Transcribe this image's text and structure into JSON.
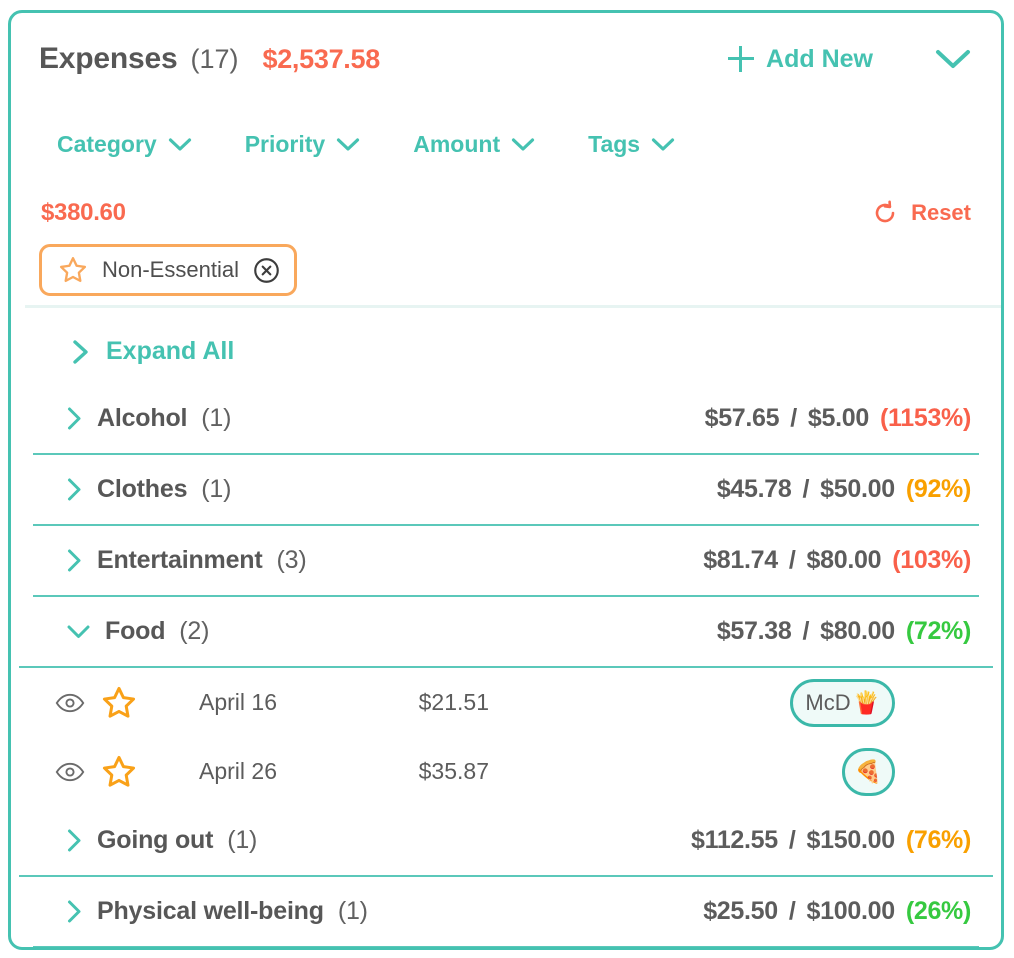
{
  "header": {
    "title": "Expenses",
    "count": "(17)",
    "grand_total": "$2,537.58",
    "add_new_label": "Add New",
    "plus_icon": "plus-icon",
    "collapse_icon": "chevron-down-icon"
  },
  "filters": [
    {
      "label": "Category",
      "icon": "chevron-down-icon"
    },
    {
      "label": "Priority",
      "icon": "chevron-down-icon"
    },
    {
      "label": "Amount",
      "icon": "chevron-down-icon"
    },
    {
      "label": "Tags",
      "icon": "chevron-down-icon"
    }
  ],
  "subtotal": {
    "filtered_total": "$380.60",
    "reset_label": "Reset",
    "reset_icon": "refresh-ccw-icon"
  },
  "chips": [
    {
      "label": "Non-Essential",
      "star_icon": "star-outline-icon",
      "close_icon": "close-circle-icon"
    }
  ],
  "list": {
    "expand_all_label": "Expand All",
    "expand_all_icon": "chevron-right-icon",
    "categories": [
      {
        "name": "Alcohol",
        "count": "(1)",
        "spent": "$57.65",
        "separator": "/",
        "budget": "$5.00",
        "percent": "(1153%)",
        "percent_color": "#f9604a",
        "expanded": false,
        "chevron": "chevron-right-icon",
        "expenses": []
      },
      {
        "name": "Clothes",
        "count": "(1)",
        "spent": "$45.78",
        "separator": "/",
        "budget": "$50.00",
        "percent": "(92%)",
        "percent_color": "#f9a000",
        "expanded": false,
        "chevron": "chevron-right-icon",
        "expenses": []
      },
      {
        "name": "Entertainment",
        "count": "(3)",
        "spent": "$81.74",
        "separator": "/",
        "budget": "$80.00",
        "percent": "(103%)",
        "percent_color": "#f9604a",
        "expanded": false,
        "chevron": "chevron-right-icon",
        "expenses": []
      },
      {
        "name": "Food",
        "count": "(2)",
        "spent": "$57.38",
        "separator": "/",
        "budget": "$80.00",
        "percent": "(72%)",
        "percent_color": "#36c940",
        "expanded": true,
        "chevron": "chevron-down-icon",
        "expenses": [
          {
            "eye_icon": "eye-icon",
            "star_icon": "star-outline-icon",
            "date": "April 16",
            "amount": "$21.51",
            "tags": [
              {
                "label": "McD",
                "emoji": "🍟",
                "shape": "pill"
              }
            ]
          },
          {
            "eye_icon": "eye-icon",
            "star_icon": "star-outline-icon",
            "date": "April 26",
            "amount": "$35.87",
            "tags": [
              {
                "label": "",
                "emoji": "🍕",
                "shape": "round"
              }
            ]
          }
        ]
      },
      {
        "name": "Going out",
        "count": "(1)",
        "spent": "$112.55",
        "separator": "/",
        "budget": "$150.00",
        "percent": "(76%)",
        "percent_color": "#f9a000",
        "expanded": false,
        "chevron": "chevron-right-icon",
        "expenses": []
      },
      {
        "name": "Physical well-being",
        "count": "(1)",
        "spent": "$25.50",
        "separator": "/",
        "budget": "$100.00",
        "percent": "(26%)",
        "percent_color": "#36c940",
        "expanded": false,
        "chevron": "chevron-right-icon",
        "expenses": []
      }
    ]
  },
  "colors": {
    "teal": "#45c2b1",
    "coral": "#f96a50",
    "orange": "#f9a85c",
    "gray_text": "#575757",
    "divider": "#5bc8ba"
  }
}
